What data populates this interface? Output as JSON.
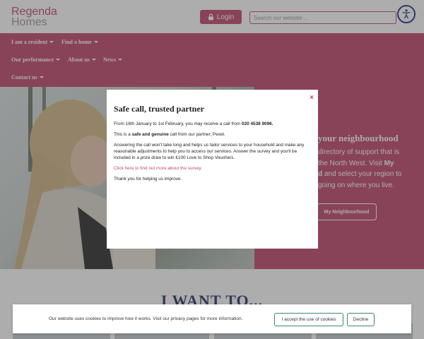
{
  "header": {
    "logo_top": "Regenda",
    "logo_bottom": "Homes",
    "login_label": "Login",
    "search_placeholder": "Search our website ..."
  },
  "nav": {
    "items": [
      {
        "label": "I am a resident"
      },
      {
        "label": "Find a home"
      },
      {
        "label": "Our performance"
      },
      {
        "label": "About us"
      },
      {
        "label": "News"
      },
      {
        "label": "Contact us"
      }
    ]
  },
  "hero": {
    "title_visible": "your neighbourhood",
    "text_line1": "directory of support that is",
    "text_line2": "the North West. Visit",
    "text_bold1": "My",
    "text_bold2": "d",
    "text_line3": "and select your region to",
    "text_line4": "going on where you live.",
    "button_label": "My Neighbourhood"
  },
  "section": {
    "title": "I WANT TO..."
  },
  "modal": {
    "close_label": "×",
    "title": "Safe call, trusted partner",
    "p1_text": "From 16th January to 1st February, you may receive a call from ",
    "p1_phone": "020 4538 9096.",
    "p2_pre": "This is a ",
    "p2_bold": "safe and genuine",
    "p2_post": " call from our partner, Pexel.",
    "p3": "Answering the call won't take long and helps us tailor services to your household and make any reasonable adjustments to help you to access our services. Answer the survey and you'll be included in a prize draw to win £100 Love to Shop Vouchers.",
    "p4_link": "Click here to find out more about the survey.",
    "p5": "Thank you for helping us improve."
  },
  "cookie": {
    "text": "Our website uses cookies to improve how it works. Visit our privacy pages for more information.",
    "accept_label": "I accept the use of cookies",
    "decline_label": "Decline"
  },
  "colors": {
    "brand": "#c2496f",
    "navy": "#2c3a6b",
    "accept_border": "#3a8a6a"
  }
}
